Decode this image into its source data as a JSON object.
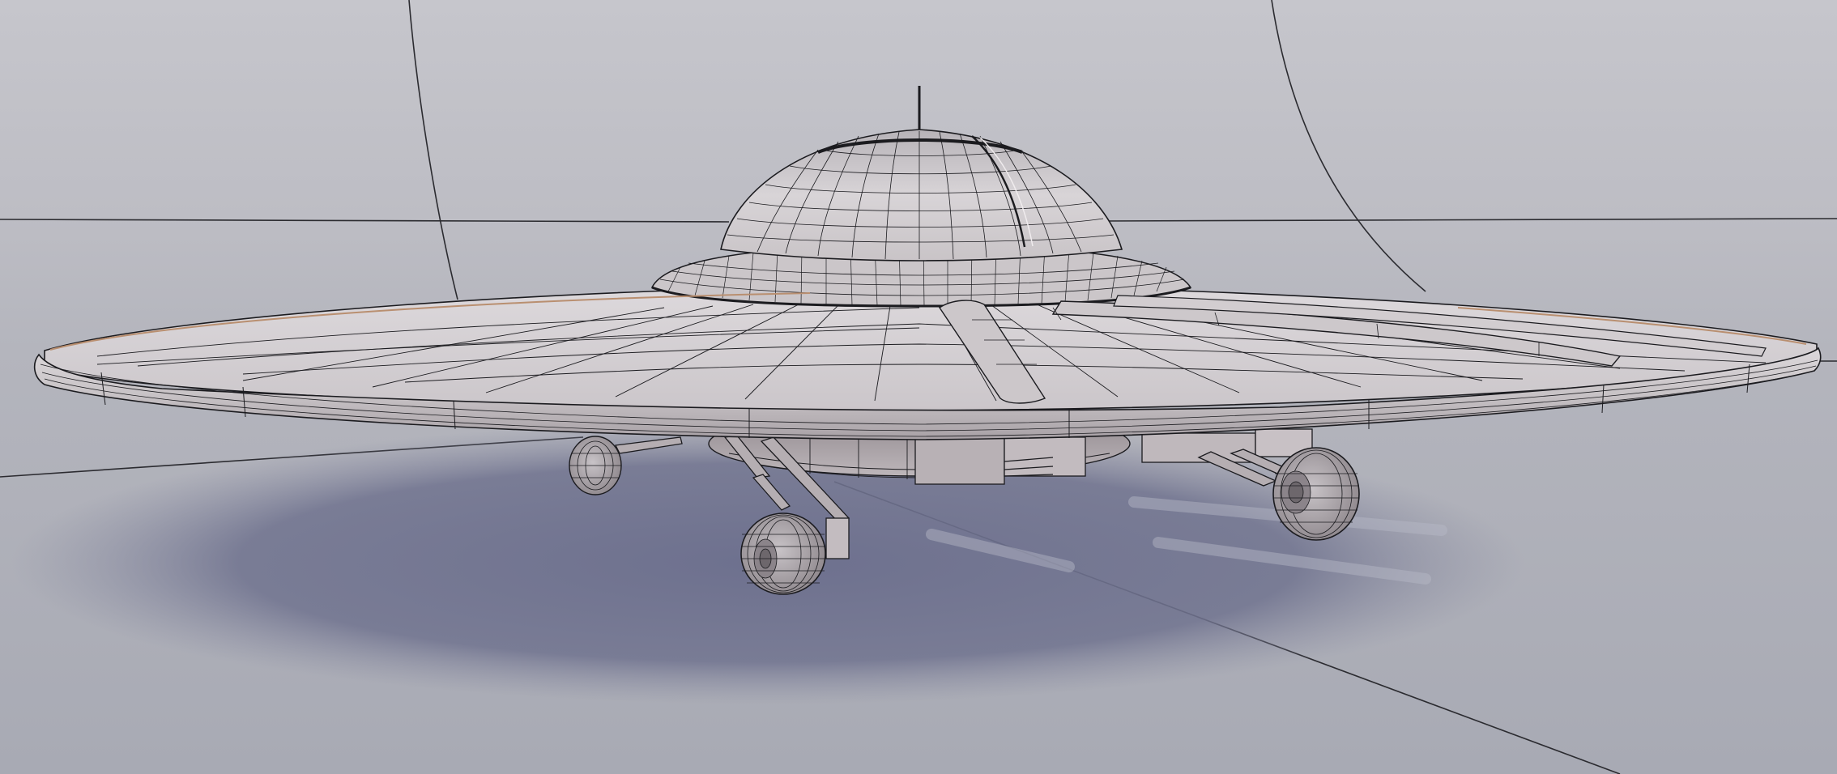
{
  "scene": {
    "subject": "flying-saucer-wireframe-model",
    "shading": "wireframe-overlay-on-solid",
    "colors": {
      "background_top": "#c3c3ca",
      "background_bottom": "#a9aab3",
      "floor": "#a3a5b0",
      "shadow": "#6f7290",
      "model_surface": "#d7d3d6",
      "model_surface_dark": "#a49ea2",
      "wire": "#1b1b1f",
      "accent_trim": "#b98f70"
    }
  }
}
